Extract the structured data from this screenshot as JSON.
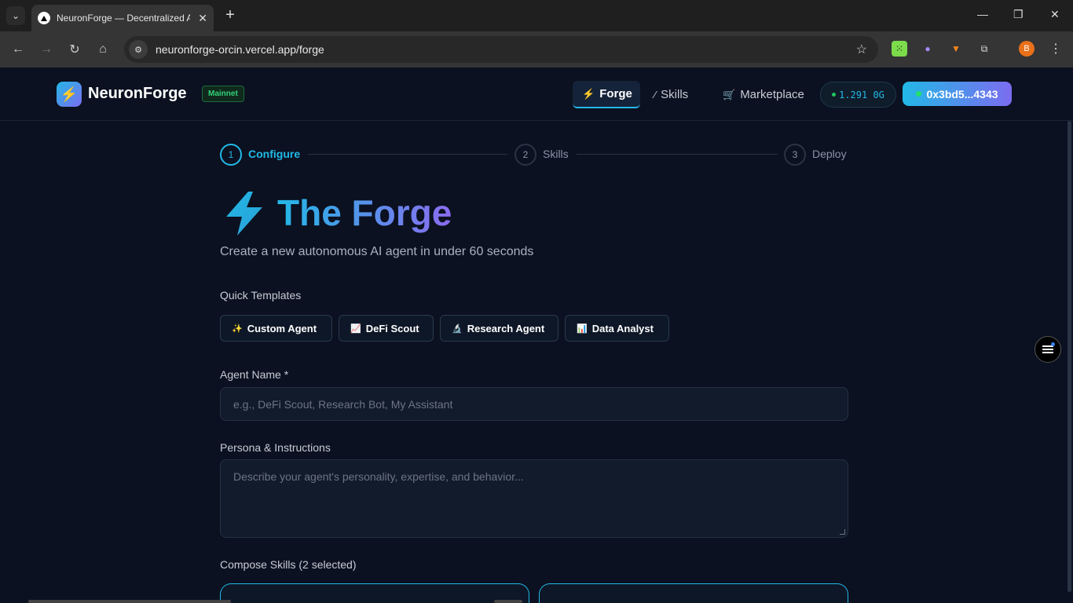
{
  "browser": {
    "tab_title": "NeuronForge — Decentralized AI",
    "url": "neuronforge-orcin.vercel.app/forge",
    "profile_initial": "B"
  },
  "header": {
    "logo_text": "NeuronForge",
    "network_badge": "Mainnet",
    "nav": [
      {
        "label": "Forge",
        "icon": "lightning-icon"
      },
      {
        "label": "Skills",
        "icon": "wand-icon"
      },
      {
        "label": "Marketplace",
        "icon": "cart-icon"
      }
    ],
    "balance": "1.291 0G",
    "wallet": "0x3bd5...4343"
  },
  "stepper": [
    {
      "number": "1",
      "label": "Configure"
    },
    {
      "number": "2",
      "label": "Skills"
    },
    {
      "number": "3",
      "label": "Deploy"
    }
  ],
  "main": {
    "title": "The Forge",
    "subtitle": "Create a new autonomous AI agent in under 60 seconds",
    "templates_label": "Quick Templates",
    "templates": [
      {
        "label": "Custom Agent",
        "icon": "✨"
      },
      {
        "label": "DeFi Scout",
        "icon": "📈"
      },
      {
        "label": "Research Agent",
        "icon": "🔬"
      },
      {
        "label": "Data Analyst",
        "icon": "📊"
      }
    ],
    "agent_name_label": "Agent Name *",
    "agent_name_placeholder": "e.g., DeFi Scout, Research Bot, My Assistant",
    "persona_label": "Persona & Instructions",
    "persona_placeholder": "Describe your agent's personality, expertise, and behavior...",
    "skills_label": "Compose Skills (2 selected)"
  },
  "colors": {
    "accent": "#22b8e6",
    "accent_purple": "#7c6cf0",
    "background": "#0b1120"
  }
}
